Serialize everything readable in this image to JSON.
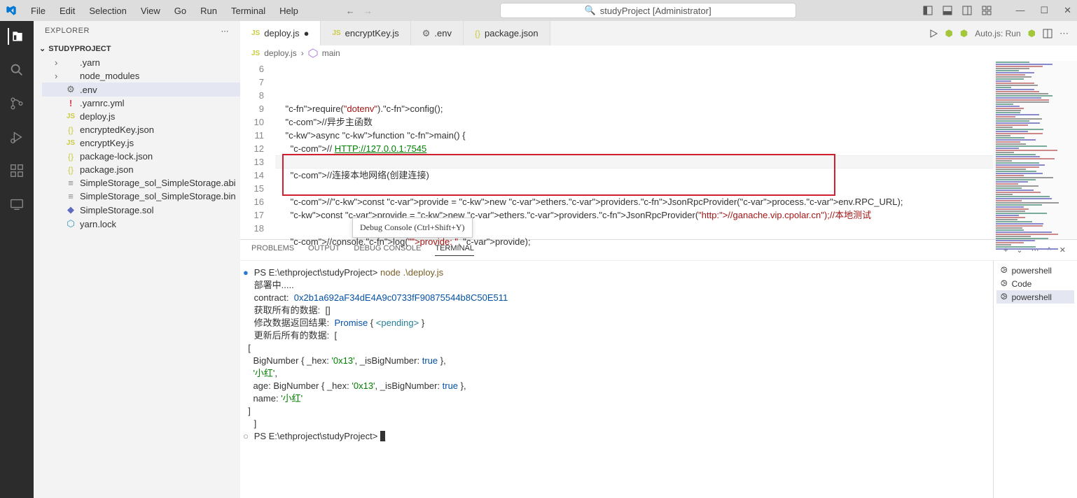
{
  "titlebar": {
    "menu": [
      "File",
      "Edit",
      "Selection",
      "View",
      "Go",
      "Run",
      "Terminal",
      "Help"
    ],
    "title": "studyProject [Administrator]"
  },
  "titleActions": {
    "autojs": "Auto.js: Run"
  },
  "sidebar": {
    "header": "EXPLORER",
    "project": "STUDYPROJECT",
    "items": [
      {
        "name": ".yarn",
        "icon": "folder",
        "chev": "›"
      },
      {
        "name": "node_modules",
        "icon": "folder",
        "chev": "›"
      },
      {
        "name": ".env",
        "icon": "gear",
        "selected": true
      },
      {
        "name": ".yarnrc.yml",
        "icon": "excl"
      },
      {
        "name": "deploy.js",
        "icon": "js"
      },
      {
        "name": "encryptedKey.json",
        "icon": "json"
      },
      {
        "name": "encryptKey.js",
        "icon": "js"
      },
      {
        "name": "package-lock.json",
        "icon": "json"
      },
      {
        "name": "package.json",
        "icon": "json"
      },
      {
        "name": "SimpleStorage_sol_SimpleStorage.abi",
        "icon": "lines"
      },
      {
        "name": "SimpleStorage_sol_SimpleStorage.bin",
        "icon": "lines"
      },
      {
        "name": "SimpleStorage.sol",
        "icon": "sol"
      },
      {
        "name": "yarn.lock",
        "icon": "yarn"
      }
    ]
  },
  "tabs": [
    {
      "label": "deploy.js",
      "icon": "js",
      "active": true,
      "dirty": true
    },
    {
      "label": "encryptKey.js",
      "icon": "js"
    },
    {
      "label": ".env",
      "icon": "gear"
    },
    {
      "label": "package.json",
      "icon": "json"
    }
  ],
  "breadcrumb": {
    "file": "deploy.js",
    "symbol": "main"
  },
  "code": {
    "startLine": 6,
    "tooltip": "Debug Console (Ctrl+Shift+Y)",
    "lines": [
      "",
      "    require(\"dotenv\").config();",
      "    //异步主函数",
      "    async function main() {",
      "      // HTTP://127.0.0.1:7545",
      "",
      "      //连接本地网络(创建连接)",
      "",
      "      //const provide = new ethers.providers.JsonRpcProvider(process.env.RPC_URL);",
      "      const provide = new ethers.providers.JsonRpcProvider(\"http://ganache.vip.cpolar.cn\");//本地测试",
      "",
      "      //console.log(\"provide: \", provide);",
      ""
    ]
  },
  "panel": {
    "tabs": [
      "PROBLEMS",
      "OUTPUT",
      "DEBUG CONSOLE",
      "TERMINAL"
    ],
    "active": 3,
    "terminals": [
      {
        "name": "powershell"
      },
      {
        "name": "Code"
      },
      {
        "name": "powershell",
        "active": true
      }
    ],
    "prompt1": "PS E:\\ethproject\\studyProject> ",
    "cmd1": "node .\\deploy.js",
    "l2": "部署中.....",
    "l3a": "contract:  ",
    "l3b": "0x2b1a692aF34dE4A9c0733fF90875544b8C50E511",
    "l4a": "获取所有的数据:  ",
    "l4b": "[]",
    "l5a": "修改数据返回结果:  ",
    "l5b": "Promise",
    "l5c": " { ",
    "l5d": "<pending>",
    "l5e": " }",
    "l6a": "更新后所有的数据:  ",
    "l6b": "[",
    "l7": "  [",
    "l8a": "    BigNumber { _hex: ",
    "l8b": "'0x13'",
    "l8c": ", _isBigNumber: ",
    "l8d": "true",
    "l8e": " },",
    "l9a": "    ",
    "l9b": "'小红'",
    "l9c": ",",
    "l10a": "    age: BigNumber { _hex: ",
    "l10b": "'0x13'",
    "l10c": ", _isBigNumber: ",
    "l10d": "true",
    "l10e": " },",
    "l11a": "    name: ",
    "l11b": "'小红'",
    "l12": "  ]",
    "l13": "]",
    "prompt2": "PS E:\\ethproject\\studyProject> "
  }
}
